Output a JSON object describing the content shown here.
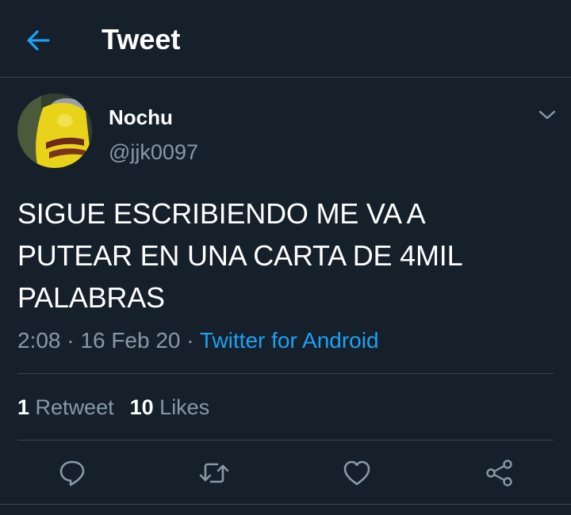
{
  "header": {
    "title": "Tweet",
    "back_icon": "arrow-left-icon"
  },
  "tweet": {
    "author": {
      "display_name": "Nochu",
      "username": "@jjk0097"
    },
    "text": "SIGUE ESCRIBIENDO ME VA A\nPUTEAR EN UNA CARTA DE 4MIL\nPALABRAS",
    "time": "2:08",
    "date": "16 Feb 20",
    "separator": "·",
    "source": "Twitter for Android"
  },
  "stats": {
    "retweets_count": "1",
    "retweets_label": "Retweet",
    "likes_count": "10",
    "likes_label": "Likes"
  },
  "actions": [
    "reply-icon",
    "retweet-icon",
    "like-icon",
    "share-icon"
  ],
  "colors": {
    "background": "#15202b",
    "accent": "#1da1f2",
    "secondary_text": "#8899a6",
    "divider": "#38444d"
  }
}
